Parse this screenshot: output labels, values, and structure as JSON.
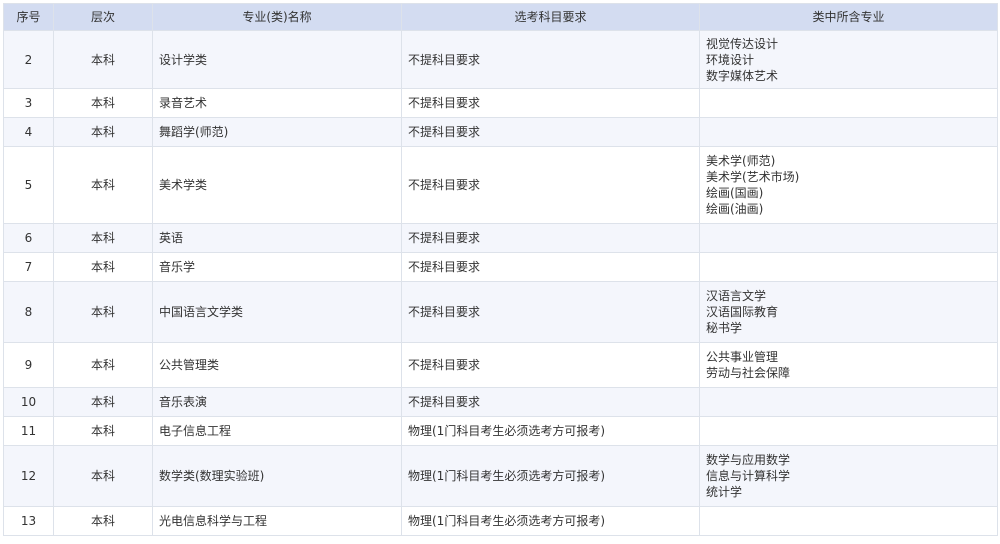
{
  "table": {
    "headers": [
      "序号",
      "层次",
      "专业(类)名称",
      "选考科目要求",
      "类中所含专业"
    ],
    "rows": [
      {
        "idx": "2",
        "level": "本科",
        "name": "设计学类",
        "req": "不提科目要求",
        "subs": [
          "视觉传达设计",
          "环境设计",
          "数字媒体艺术"
        ]
      },
      {
        "idx": "3",
        "level": "本科",
        "name": "录音艺术",
        "req": "不提科目要求",
        "subs": []
      },
      {
        "idx": "4",
        "level": "本科",
        "name": "舞蹈学(师范)",
        "req": "不提科目要求",
        "subs": []
      },
      {
        "idx": "5",
        "level": "本科",
        "name": "美术学类",
        "req": "不提科目要求",
        "subs": [
          "美术学(师范)",
          "美术学(艺术市场)",
          "绘画(国画)",
          "绘画(油画)"
        ]
      },
      {
        "idx": "6",
        "level": "本科",
        "name": "英语",
        "req": "不提科目要求",
        "subs": []
      },
      {
        "idx": "7",
        "level": "本科",
        "name": "音乐学",
        "req": "不提科目要求",
        "subs": []
      },
      {
        "idx": "8",
        "level": "本科",
        "name": "中国语言文学类",
        "req": "不提科目要求",
        "subs": [
          "汉语言文学",
          "汉语国际教育",
          "秘书学"
        ]
      },
      {
        "idx": "9",
        "level": "本科",
        "name": "公共管理类",
        "req": "不提科目要求",
        "subs": [
          "公共事业管理",
          "劳动与社会保障"
        ]
      },
      {
        "idx": "10",
        "level": "本科",
        "name": "音乐表演",
        "req": "不提科目要求",
        "subs": []
      },
      {
        "idx": "11",
        "level": "本科",
        "name": "电子信息工程",
        "req": "物理(1门科目考生必须选考方可报考)",
        "subs": []
      },
      {
        "idx": "12",
        "level": "本科",
        "name": "数学类(数理实验班)",
        "req": "物理(1门科目考生必须选考方可报考)",
        "subs": [
          "数学与应用数学",
          "信息与计算科学",
          "统计学"
        ]
      },
      {
        "idx": "13",
        "level": "本科",
        "name": "光电信息科学与工程",
        "req": "物理(1门科目考生必须选考方可报考)",
        "subs": []
      }
    ]
  }
}
